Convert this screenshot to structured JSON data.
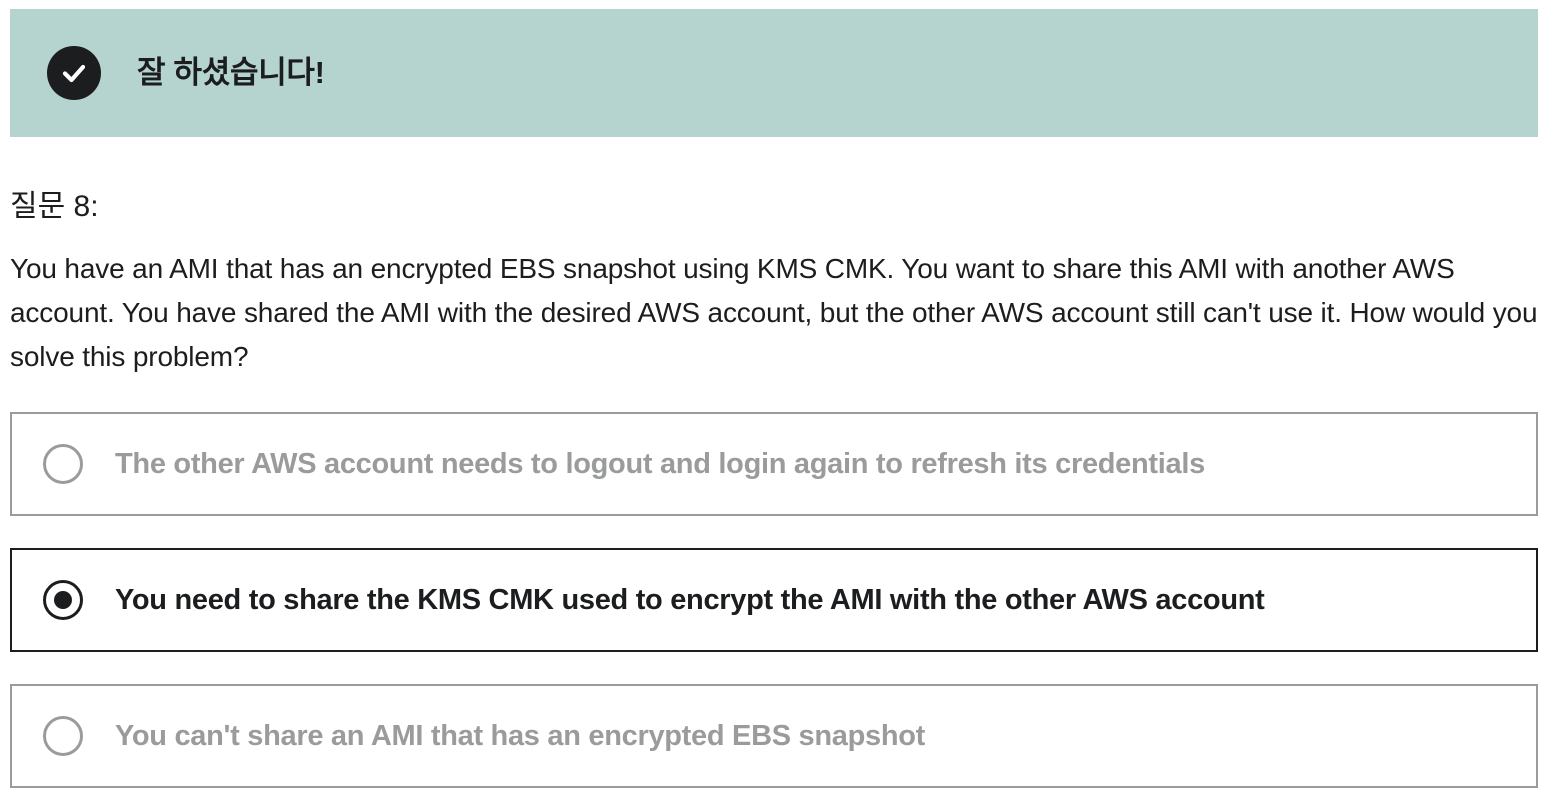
{
  "banner": {
    "message": "잘 하셨습니다!",
    "icon": "check-circle-icon",
    "background_color": "#b5d4cf"
  },
  "question": {
    "number_label": "질문 8:",
    "text": "You have an AMI that has an encrypted EBS snapshot using KMS CMK. You want to share this AMI with another AWS account. You have shared the AMI with the desired AWS account, but the other AWS account still can't use it. How would you solve this problem?"
  },
  "options": [
    {
      "label": "The other AWS account needs to logout and login again to refresh its credentials",
      "selected": false
    },
    {
      "label": "You need to share the KMS CMK used to encrypt the AMI with the other AWS account",
      "selected": true
    },
    {
      "label": "You can't share an AMI that has an encrypted EBS snapshot",
      "selected": false
    }
  ],
  "colors": {
    "text_primary": "#1c1d1f",
    "text_muted": "#9a9b9c",
    "border_muted": "#9a9b9c"
  }
}
